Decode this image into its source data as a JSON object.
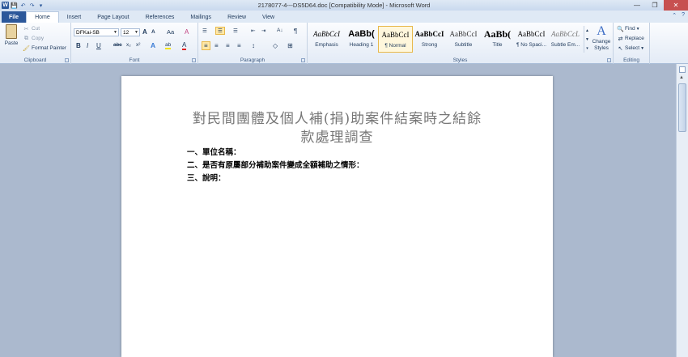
{
  "window": {
    "title": "2178077-4---DS5D64.doc [Compatibility Mode] - Microsoft Word",
    "app_icon": "W",
    "minimize_glyph": "—",
    "maximize_glyph": "❐",
    "close_glyph": "✕"
  },
  "qat": {
    "save_glyph": "💾",
    "undo_glyph": "↶",
    "redo_glyph": "↷",
    "customize_glyph": "▾"
  },
  "tabs": [
    {
      "label": "File"
    },
    {
      "label": "Home"
    },
    {
      "label": "Insert"
    },
    {
      "label": "Page Layout"
    },
    {
      "label": "References"
    },
    {
      "label": "Mailings"
    },
    {
      "label": "Review"
    },
    {
      "label": "View"
    }
  ],
  "tab_right": {
    "help_glyph": "?",
    "collapse_glyph": "⌃"
  },
  "ribbon": {
    "clipboard": {
      "label": "Clipboard",
      "paste": "Paste",
      "cut": "Cut",
      "copy": "Copy",
      "format_painter": "Format Painter"
    },
    "font": {
      "label": "Font",
      "font_name": "DFKai-SB",
      "font_size": "12",
      "grow": "A",
      "shrink": "A",
      "change_case": "Aa",
      "clear": "A",
      "bold": "B",
      "italic": "I",
      "underline": "U",
      "strike": "abc",
      "subscript": "x₂",
      "superscript": "x²",
      "effects": "A",
      "highlight": "ab",
      "font_color": "A"
    },
    "paragraph": {
      "label": "Paragraph",
      "bullets": "☰",
      "numbering": "☰",
      "multilevel": "☰",
      "decrease_indent": "⇤",
      "increase_indent": "⇥",
      "sort": "A↓",
      "show_marks": "¶",
      "align_left": "≡",
      "center": "≡",
      "align_right": "≡",
      "justify": "≡",
      "line_spacing": "↕",
      "shading": "◇",
      "borders": "⊞"
    },
    "styles": {
      "label": "Styles",
      "items": [
        {
          "preview": "AaBbCcI",
          "name": "Emphasis"
        },
        {
          "preview": "AaBb(",
          "name": "Heading 1"
        },
        {
          "preview": "AaBbCcI",
          "name": "¶ Normal"
        },
        {
          "preview": "AaBbCcI",
          "name": "Strong"
        },
        {
          "preview": "AaBbCcI",
          "name": "Subtitle"
        },
        {
          "preview": "AaBb(",
          "name": "Title"
        },
        {
          "preview": "AaBbCcI",
          "name": "¶ No Spaci..."
        },
        {
          "preview": "AaBbCcL",
          "name": "Subtle Em..."
        }
      ],
      "change_styles": "Change Styles",
      "change_styles_icon": "A"
    },
    "editing": {
      "label": "Editing",
      "find": "Find",
      "replace": "Replace",
      "select": "Select"
    }
  },
  "document": {
    "title_line1": "對民間團體及個人補(捐)助案件結案時之結餘",
    "title_line2": "款處理調查",
    "lines": [
      "一、單位名稱：",
      "二、是否有原屬部分補助案件變成全額補助之情形：",
      "三、說明："
    ]
  },
  "colors": {
    "file_tab": "#2b579a",
    "workspace": "#abb9ce",
    "selected_style": "#e8b84a",
    "close_button": "#c75050"
  }
}
